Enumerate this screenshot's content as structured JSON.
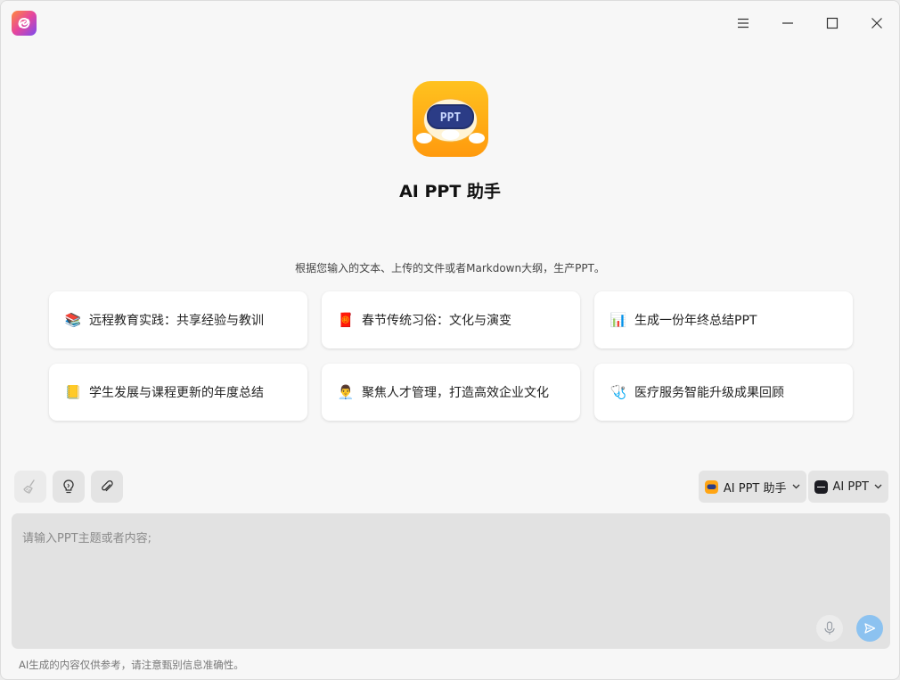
{
  "hero": {
    "title": "AI PPT 助手",
    "icon_text": "PPT"
  },
  "subtitle": "根据您输入的文本、上传的文件或者Markdown大纲，生产PPT。",
  "suggestions": [
    {
      "icon": "📚",
      "icon_name": "books-icon",
      "label": "远程教育实践：共享经验与教训"
    },
    {
      "icon": "🧧",
      "icon_name": "red-envelope-icon",
      "label": "春节传统习俗：文化与演变"
    },
    {
      "icon": "📊",
      "icon_name": "bar-chart-icon",
      "label": "生成一份年终总结PPT"
    },
    {
      "icon": "📒",
      "icon_name": "notebook-icon",
      "label": "学生发展与课程更新的年度总结"
    },
    {
      "icon": "👨‍💼",
      "icon_name": "person-icon",
      "label": "聚焦人才管理，打造高效企业文化"
    },
    {
      "icon": "🩺",
      "icon_name": "stethoscope-icon",
      "label": "医疗服务智能升级成果回顾"
    }
  ],
  "toolbar": {
    "assistant_select": "AI PPT 助手",
    "model_select": "AI PPT"
  },
  "input": {
    "placeholder": "请输入PPT主题或者内容;"
  },
  "disclaimer": "AI生成的内容仅供参考，请注意甄别信息准确性。",
  "colors": {
    "send_button": "#8cc2f0",
    "hero_orange": "#ffa514",
    "window_bg": "#f7f7f7"
  }
}
